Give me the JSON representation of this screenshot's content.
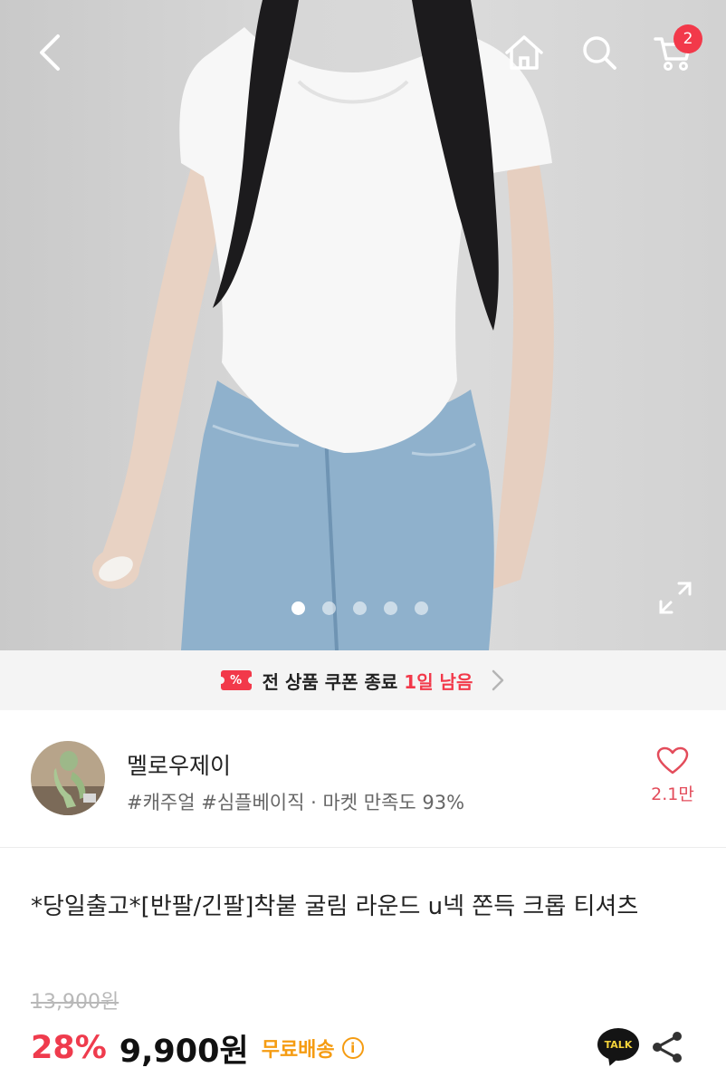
{
  "colors": {
    "accent": "#f2394a",
    "discount": "#ef3b4d",
    "shipping": "#f59c12",
    "like": "#e34c5b"
  },
  "header": {
    "back_icon": "chevron-left-icon",
    "home_icon": "home-icon",
    "search_icon": "search-icon",
    "cart_icon": "cart-icon",
    "cart_count": "2"
  },
  "gallery": {
    "image_count": 5,
    "active_index": 0,
    "expand_icon": "expand-icon"
  },
  "coupon": {
    "icon_glyph": "%",
    "text": "전 상품 쿠폰 종료",
    "remaining": "1일 남음"
  },
  "seller": {
    "name": "멜로우제이",
    "tags": "#캐주얼 #심플베이직 · 마켓 만족도 93%",
    "like_count": "2.1만"
  },
  "product": {
    "title": "*당일출고*[반팔/긴팔]착붙 굴림 라운드 u넥 쫀득 크롭 티셔츠",
    "original_price": "13,900원",
    "discount": "28%",
    "price": "9,900원",
    "shipping": "무료배송",
    "info_glyph": "i",
    "talk_label": "TALK"
  }
}
